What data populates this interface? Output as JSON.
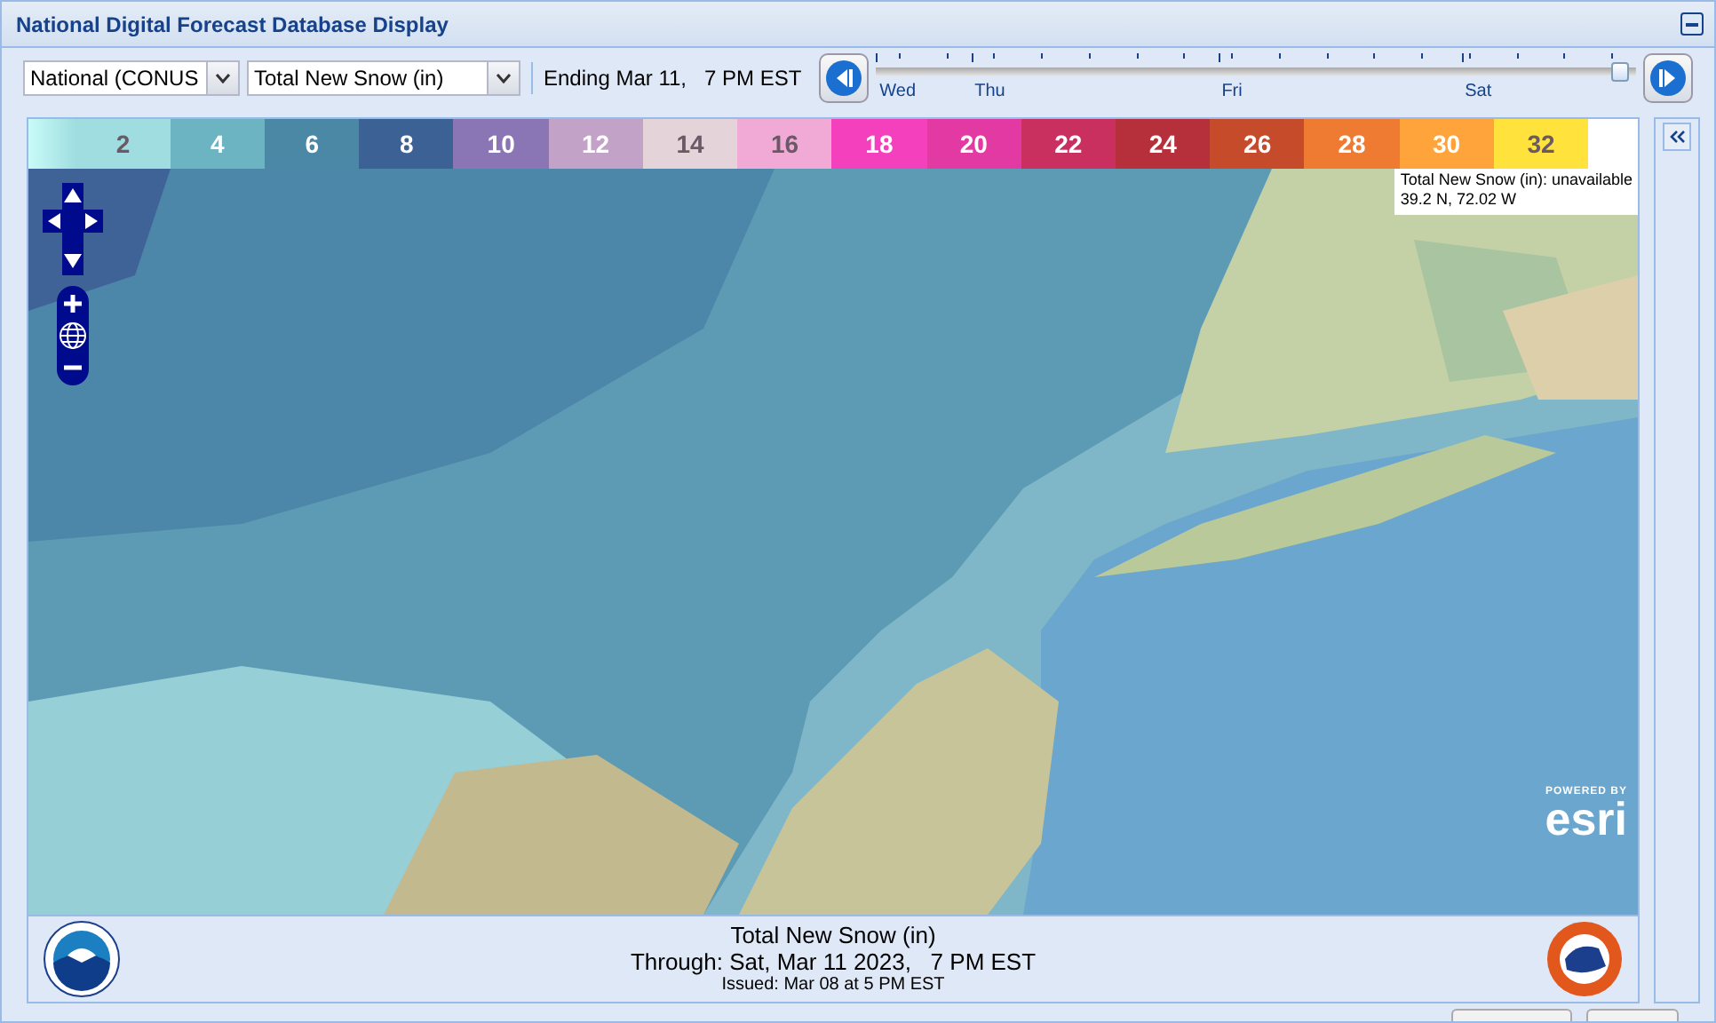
{
  "window": {
    "title": "National Digital Forecast Database Display"
  },
  "toolbar": {
    "region": {
      "value": "National (CONUS"
    },
    "element": {
      "value": "Total New Snow (in)"
    },
    "ending": "Ending Mar 11,   7 PM EST"
  },
  "timeline": {
    "days": [
      {
        "label": "Wed"
      },
      {
        "label": "Thu"
      },
      {
        "label": "Fri"
      },
      {
        "label": "Sat"
      }
    ],
    "level": 0.99
  },
  "legend": [
    {
      "label": "2",
      "color": "#9fdde0"
    },
    {
      "label": "4",
      "color": "#6db4c2"
    },
    {
      "label": "6",
      "color": "#4a88a6"
    },
    {
      "label": "8",
      "color": "#3c6194"
    },
    {
      "label": "10",
      "color": "#8a76b4"
    },
    {
      "label": "12",
      "color": "#c3a2c8"
    },
    {
      "label": "14",
      "color": "#e4d3d8"
    },
    {
      "label": "16",
      "color": "#f1a9d6"
    },
    {
      "label": "18",
      "color": "#f540be"
    },
    {
      "label": "20",
      "color": "#e23aa2"
    },
    {
      "label": "22",
      "color": "#c9305f"
    },
    {
      "label": "24",
      "color": "#b5303a"
    },
    {
      "label": "26",
      "color": "#c54b2b"
    },
    {
      "label": "28",
      "color": "#ef7a31"
    },
    {
      "label": "30",
      "color": "#ffa43b"
    },
    {
      "label": "32",
      "color": "#ffe23c"
    }
  ],
  "map": {
    "kind": "picture",
    "info": {
      "line_1": "Total New Snow (in): unavailable",
      "line_2": "39.2 N, 72.02 W"
    },
    "attribution": {
      "top": "POWERED BY",
      "brand": "esri"
    }
  },
  "footer": {
    "title": "Total New Snow (in)",
    "through": "Through: Sat, Mar 11 2023,   7 PM EST",
    "issued": "Issued: Mar 08 at 5 PM EST"
  },
  "sidebar": {
    "expanded": false
  }
}
